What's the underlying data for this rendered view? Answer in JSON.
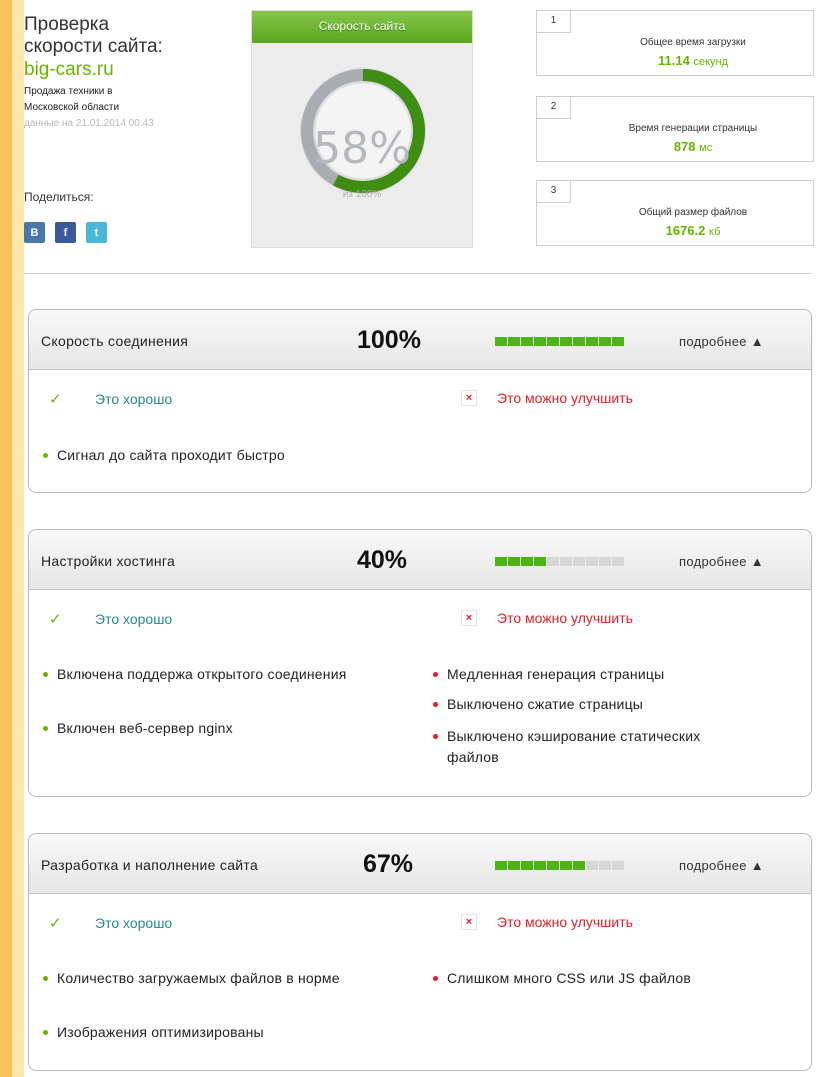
{
  "header": {
    "title_line1": "Проверка",
    "title_line2": "скорости сайта:",
    "domain": "big-cars.ru",
    "desc_line1": "Продажа техники в",
    "desc_line2": "Московской области",
    "date": "данные на 21.01.2014 00:43",
    "share_label": "Поделиться:"
  },
  "share": [
    {
      "label": "B",
      "icon": "vk-icon",
      "color": "#4a76a8"
    },
    {
      "label": "f",
      "icon": "facebook-icon",
      "color": "#3b5998"
    },
    {
      "label": "t",
      "icon": "twitter-icon",
      "color": "#4ab8d8"
    }
  ],
  "gauge": {
    "title": "Скорость сайта",
    "value": "58%",
    "percent": 58,
    "sub": "из 100%"
  },
  "metrics": [
    {
      "num": "1",
      "label": "Общее время загрузки",
      "value": "11.14",
      "unit": "секунд"
    },
    {
      "num": "2",
      "label": "Время генерации страницы",
      "value": "878",
      "unit": "мс"
    },
    {
      "num": "3",
      "label": "Общий размер файлов",
      "value": "1676.2",
      "unit": "кб"
    }
  ],
  "sections": [
    {
      "title": "Скорость соединения",
      "percent": "100%",
      "filled": 10,
      "more": "подробнее ▲",
      "good_label": "Это хорошо",
      "bad_label": "Это можно улучшить",
      "good": [
        "Сигнал до сайта проходит быстро"
      ],
      "bad": []
    },
    {
      "title": "Настройки хостинга",
      "percent": "40%",
      "filled": 4,
      "more": "подробнее ▲",
      "good_label": "Это хорошо",
      "bad_label": "Это можно улучшить",
      "good": [
        "Включена поддержа открытого соединения",
        "Включен веб-сервер nginx"
      ],
      "bad": [
        "Медленная генерация страницы",
        "Выключено сжатие страницы",
        "Выключено кэширование статических файлов"
      ]
    },
    {
      "title": "Разработка и наполнение сайта",
      "percent": "67%",
      "filled": 7,
      "more": "подробнее ▲",
      "good_label": "Это хорошо",
      "bad_label": "Это можно улучшить",
      "good": [
        "Количество загружаемых файлов в норме",
        "Изображения оптимизированы"
      ],
      "bad": [
        "Слишком много CSS или JS файлов"
      ]
    }
  ]
}
